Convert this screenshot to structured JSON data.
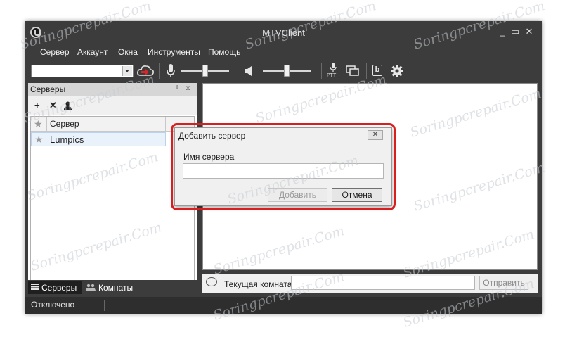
{
  "window": {
    "title": "MTVClient"
  },
  "menu": [
    "Сервер",
    "Аккаунт",
    "Окна",
    "Инструменты",
    "Помощь"
  ],
  "toolbar": {
    "server_combo_value": "",
    "icons": [
      "cloud-connect-icon",
      "microphone-icon",
      "speaker-icon",
      "ptt-microphone-icon",
      "windows-icon",
      "b-icon",
      "gear-icon"
    ],
    "ptt_label": "PTT",
    "b_label": "b",
    "mic_volume": 0.5,
    "speaker_volume": 0.5
  },
  "left_panel": {
    "title": "Серверы",
    "pin": "ᵖ",
    "close": "x",
    "tools": [
      "add-icon",
      "delete-icon",
      "user-icon"
    ],
    "list": {
      "columns": [
        "Сервер"
      ],
      "rows": [
        {
          "name": "Lumpics",
          "favorite": false
        }
      ]
    }
  },
  "bottom_tabs": [
    {
      "label": "Серверы",
      "active": true
    },
    {
      "label": "Комнаты",
      "active": false
    }
  ],
  "input_row": {
    "room_label": "Текущая комната",
    "message_value": "",
    "send_label": "Отправить"
  },
  "status": {
    "text": "Отключено"
  },
  "dialog": {
    "title": "Добавить сервер",
    "field_label": "Имя сервера",
    "field_value": "",
    "add_label": "Добавить",
    "cancel_label": "Отмена",
    "highlight_color": "#d81e1e"
  },
  "watermark": "Soringpcrepair.Com"
}
